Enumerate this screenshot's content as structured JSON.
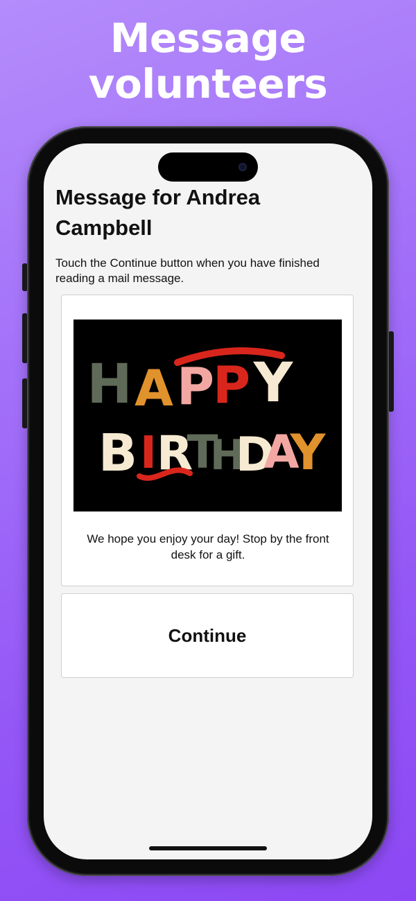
{
  "promo": {
    "headline_line1": "Message",
    "headline_line2": "volunteers"
  },
  "screen": {
    "title": "Message for Andrea Campbell",
    "instructions": "Touch the Continue button when you have finished reading a mail message.",
    "message": {
      "image_text_line1": "HAPPY",
      "image_text_line2": "BIRTHDAY",
      "body": "We hope you enjoy your day! Stop by the front desk for a gift."
    },
    "continue_label": "Continue"
  },
  "colors": {
    "background_top": "#b48cfb",
    "background_bottom": "#8c48f4",
    "screen_background": "#f4f4f4",
    "text": "#111111",
    "birthday_red": "#d9261c",
    "birthday_green": "#5f6b58",
    "birthday_orange": "#e0922c",
    "birthday_pink": "#f2a7a3",
    "birthday_cream": "#f6ead2"
  }
}
